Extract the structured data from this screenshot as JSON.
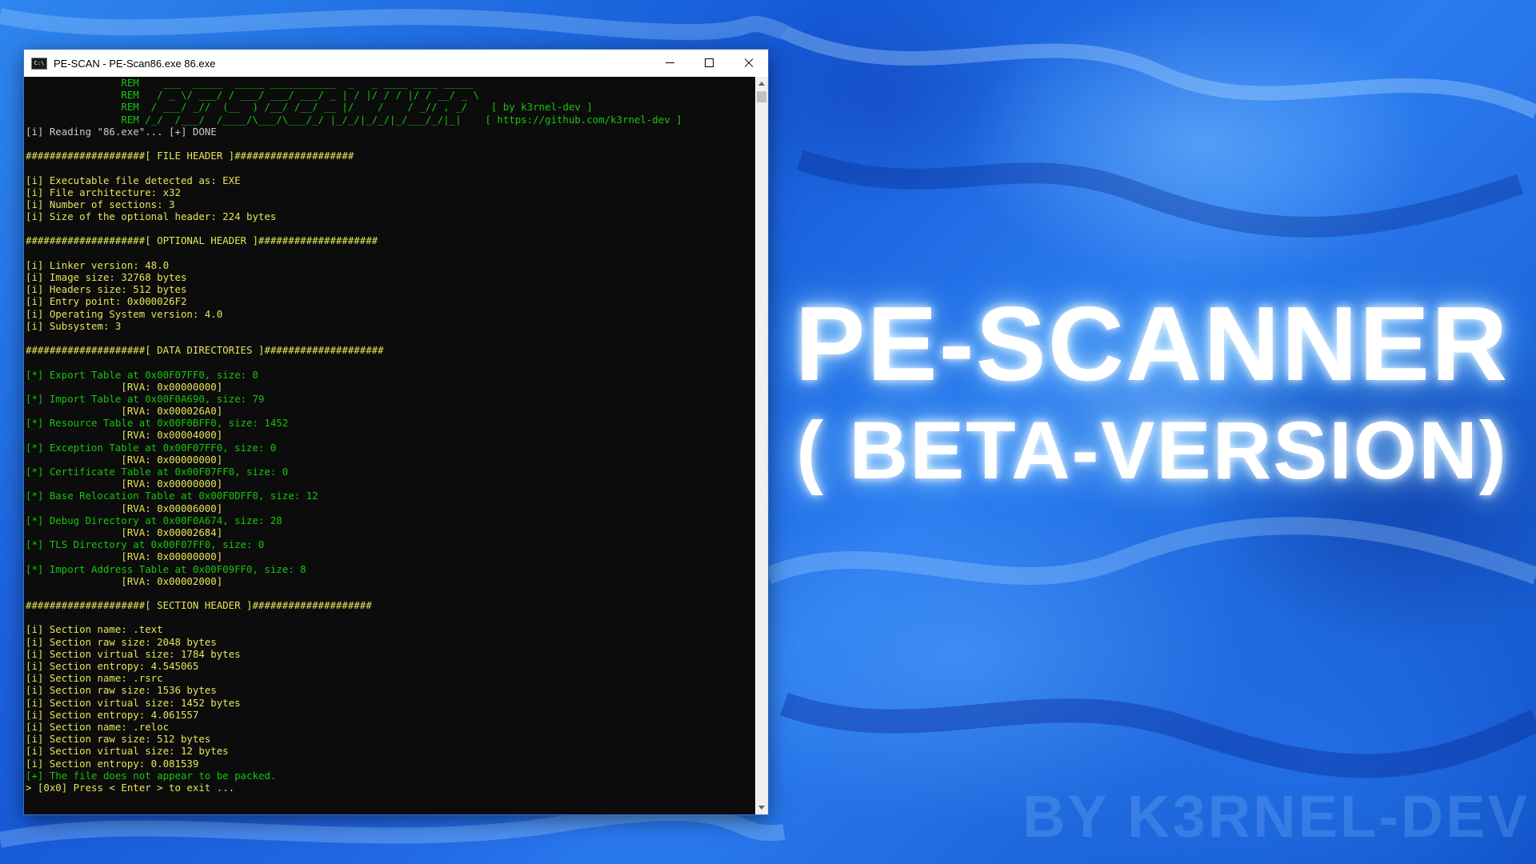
{
  "window": {
    "title": "PE-SCAN - PE-Scan86.exe  86.exe",
    "icon_text": "C:\\"
  },
  "console": {
    "lines": [
      {
        "c": "g",
        "t": "                REM    ___  _____  _____ ___________  _   _ ____ ____ _____"
      },
      {
        "c": "g",
        "t": "                REM   / _ \\/ ___/ / ___/ ___/ ___/ _ | / |/ / / |/ / __/ _ \\"
      },
      {
        "c": "g",
        "t": "                REM  / ___/ _//  (__  ) /__/ /__/ __ |/    /    / _// , _/    [ by k3rnel-dev ]"
      },
      {
        "c": "g",
        "t": "                REM /_/  /___/  /____/\\___/\\___/_/ |_/_/|_/_/|_/___/_/|_|    [ https://github.com/k3rnel-dev ]"
      },
      {
        "c": "w",
        "t": "[i] Reading \"86.exe\"... [+] DONE"
      },
      {
        "c": "w",
        "t": ""
      },
      {
        "c": "y",
        "t": "####################[ FILE HEADER ]####################"
      },
      {
        "c": "w",
        "t": ""
      },
      {
        "c": "y",
        "t": "[i] Executable file detected as: EXE"
      },
      {
        "c": "y",
        "t": "[i] File architecture: x32"
      },
      {
        "c": "y",
        "t": "[i] Number of sections: 3"
      },
      {
        "c": "y",
        "t": "[i] Size of the optional header: 224 bytes"
      },
      {
        "c": "w",
        "t": ""
      },
      {
        "c": "y",
        "t": "####################[ OPTIONAL HEADER ]####################"
      },
      {
        "c": "w",
        "t": ""
      },
      {
        "c": "y",
        "t": "[i] Linker version: 48.0"
      },
      {
        "c": "y",
        "t": "[i] Image size: 32768 bytes"
      },
      {
        "c": "y",
        "t": "[i] Headers size: 512 bytes"
      },
      {
        "c": "y",
        "t": "[i] Entry point: 0x000026F2"
      },
      {
        "c": "y",
        "t": "[i] Operating System version: 4.0"
      },
      {
        "c": "y",
        "t": "[i] Subsystem: 3"
      },
      {
        "c": "w",
        "t": ""
      },
      {
        "c": "y",
        "t": "####################[ DATA DIRECTORIES ]####################"
      },
      {
        "c": "w",
        "t": ""
      },
      {
        "c": "g",
        "t": "[*] Export Table at 0x00F07FF0, size: 0"
      },
      {
        "c": "y",
        "t": "                [RVA: 0x00000000]"
      },
      {
        "c": "g",
        "t": "[*] Import Table at 0x00F0A690, size: 79"
      },
      {
        "c": "y",
        "t": "                [RVA: 0x000026A0]"
      },
      {
        "c": "g",
        "t": "[*] Resource Table at 0x00F0BFF0, size: 1452"
      },
      {
        "c": "y",
        "t": "                [RVA: 0x00004000]"
      },
      {
        "c": "g",
        "t": "[*] Exception Table at 0x00F07FF0, size: 0"
      },
      {
        "c": "y",
        "t": "                [RVA: 0x00000000]"
      },
      {
        "c": "g",
        "t": "[*] Certificate Table at 0x00F07FF0, size: 0"
      },
      {
        "c": "y",
        "t": "                [RVA: 0x00000000]"
      },
      {
        "c": "g",
        "t": "[*] Base Relocation Table at 0x00F0DFF0, size: 12"
      },
      {
        "c": "y",
        "t": "                [RVA: 0x00006000]"
      },
      {
        "c": "g",
        "t": "[*] Debug Directory at 0x00F0A674, size: 28"
      },
      {
        "c": "y",
        "t": "                [RVA: 0x00002684]"
      },
      {
        "c": "g",
        "t": "[*] TLS Directory at 0x00F07FF0, size: 0"
      },
      {
        "c": "y",
        "t": "                [RVA: 0x00000000]"
      },
      {
        "c": "g",
        "t": "[*] Import Address Table at 0x00F09FF0, size: 8"
      },
      {
        "c": "y",
        "t": "                [RVA: 0x00002000]"
      },
      {
        "c": "w",
        "t": ""
      },
      {
        "c": "y",
        "t": "####################[ SECTION HEADER ]####################"
      },
      {
        "c": "w",
        "t": ""
      },
      {
        "c": "y",
        "t": "[i] Section name: .text"
      },
      {
        "c": "y",
        "t": "[i] Section raw size: 2048 bytes"
      },
      {
        "c": "y",
        "t": "[i] Section virtual size: 1784 bytes"
      },
      {
        "c": "y",
        "t": "[i] Section entropy: 4.545065"
      },
      {
        "c": "y",
        "t": "[i] Section name: .rsrc"
      },
      {
        "c": "y",
        "t": "[i] Section raw size: 1536 bytes"
      },
      {
        "c": "y",
        "t": "[i] Section virtual size: 1452 bytes"
      },
      {
        "c": "y",
        "t": "[i] Section entropy: 4.061557"
      },
      {
        "c": "y",
        "t": "[i] Section name: .reloc"
      },
      {
        "c": "y",
        "t": "[i] Section raw size: 512 bytes"
      },
      {
        "c": "y",
        "t": "[i] Section virtual size: 12 bytes"
      },
      {
        "c": "y",
        "t": "[i] Section entropy: 0.081539"
      },
      {
        "c": "g",
        "t": "[+] The file does not appear to be packed."
      },
      {
        "c": "y",
        "t": "> [0x0] Press < Enter > to exit ..."
      }
    ]
  },
  "banner": {
    "title": "PE-SCANNER",
    "subtitle": "( BETA-VERSION)",
    "watermark": "BY K3RNEL-DEV"
  },
  "colors": {
    "console_bg": "#0c0c0c",
    "green": "#16c60c",
    "yellow": "#e5e55b",
    "gray": "#cccccc",
    "background_blue": "#1a5fd8"
  }
}
